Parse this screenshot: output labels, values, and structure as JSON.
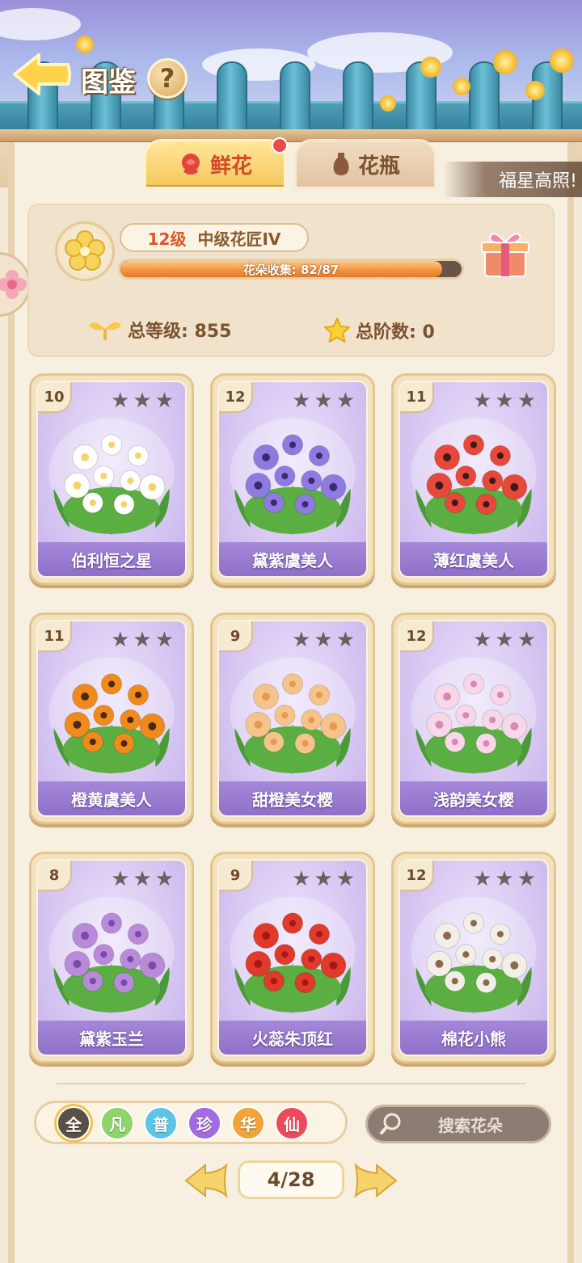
{
  "header": {
    "title": "图鉴",
    "help_label": "?"
  },
  "tabs": [
    {
      "label": "鲜花",
      "active": true,
      "icon": "rose-icon"
    },
    {
      "label": "花瓶",
      "active": false,
      "icon": "vase-icon"
    }
  ],
  "banner": {
    "text": "福星高照!"
  },
  "profile": {
    "level": "12级",
    "rank": "中级花匠IV",
    "collection_text": "花朵收集: 82/87",
    "collected": 82,
    "total": 87,
    "total_level_label": "总等级: 855",
    "total_stage_label": "总阶数: 0"
  },
  "cards": [
    {
      "level": "10",
      "name": "伯利恒之星",
      "stars": 3,
      "flower_color": "#ffffff",
      "center_color": "#f4d46a"
    },
    {
      "level": "12",
      "name": "黛紫虞美人",
      "stars": 3,
      "flower_color": "#8f7be0",
      "center_color": "#3a2a6e"
    },
    {
      "level": "11",
      "name": "薄红虞美人",
      "stars": 3,
      "flower_color": "#e8483a",
      "center_color": "#3a1a1a"
    },
    {
      "level": "11",
      "name": "橙黄虞美人",
      "stars": 3,
      "flower_color": "#f08a1c",
      "center_color": "#4a2a10"
    },
    {
      "level": "9",
      "name": "甜橙美女樱",
      "stars": 3,
      "flower_color": "#f6c48a",
      "center_color": "#e59a50"
    },
    {
      "level": "12",
      "name": "浅韵美女樱",
      "stars": 3,
      "flower_color": "#f6d8e8",
      "center_color": "#d88ab2"
    },
    {
      "level": "8",
      "name": "黛紫玉兰",
      "stars": 3,
      "flower_color": "#b88ad8",
      "center_color": "#7a4aa8"
    },
    {
      "level": "9",
      "name": "火蕊朱顶红",
      "stars": 3,
      "flower_color": "#e03a2a",
      "center_color": "#a8161a"
    },
    {
      "level": "12",
      "name": "棉花小熊",
      "stars": 3,
      "flower_color": "#f2efe8",
      "center_color": "#8a6a4a"
    }
  ],
  "filters": [
    {
      "label": "全",
      "color": "#5a5048",
      "selected": true
    },
    {
      "label": "凡",
      "color": "#8fd46a",
      "selected": false
    },
    {
      "label": "普",
      "color": "#5cc4e6",
      "selected": false
    },
    {
      "label": "珍",
      "color": "#a46ae0",
      "selected": false
    },
    {
      "label": "华",
      "color": "#f0a43a",
      "selected": false
    },
    {
      "label": "仙",
      "color": "#ec4a5a",
      "selected": false
    }
  ],
  "search": {
    "label": "搜索花朵"
  },
  "pagination": {
    "label": "4/28"
  }
}
